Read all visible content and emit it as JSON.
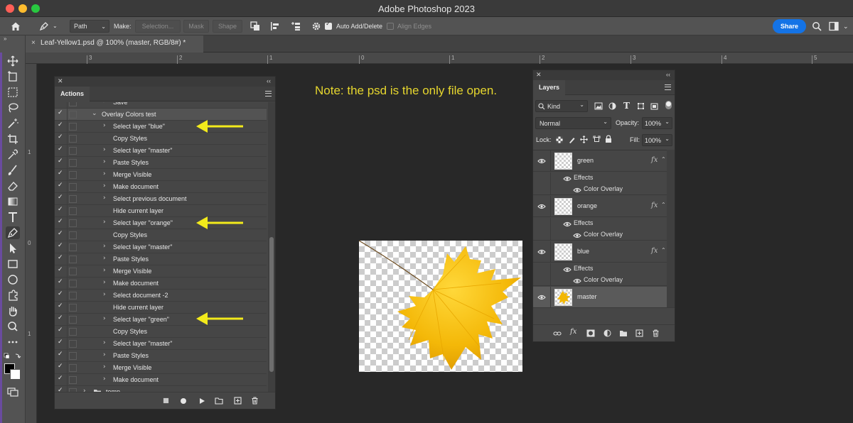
{
  "app_title": "Adobe Photoshop 2023",
  "options_bar": {
    "path_mode": "Path",
    "make_label": "Make:",
    "selection_btn": "Selection...",
    "mask_btn": "Mask",
    "shape_btn": "Shape",
    "auto_add_delete": "Auto Add/Delete",
    "align_edges": "Align Edges",
    "share": "Share"
  },
  "document_tab": {
    "close": "×",
    "title": "Leaf-Yellow1.psd @ 100% (master, RGB/8#) *"
  },
  "rulers": {
    "horizontal": [
      "3",
      "2",
      "1",
      "0",
      "1",
      "2",
      "3",
      "4",
      "5"
    ],
    "vertical": [
      "1",
      "0",
      "1"
    ]
  },
  "actions_panel": {
    "tab": "Actions",
    "rows": [
      {
        "level": 2,
        "label": "Save",
        "checked": true,
        "chevron": "›"
      },
      {
        "level": 1,
        "label": "Overlay Colors test",
        "checked": true,
        "chevron": "⌄",
        "selected": true
      },
      {
        "level": 2,
        "label": "Select layer \"blue\"",
        "checked": true,
        "chevron": "›"
      },
      {
        "level": 2,
        "label": "Copy Styles",
        "checked": true,
        "chevron": ""
      },
      {
        "level": 2,
        "label": "Select layer \"master\"",
        "checked": true,
        "chevron": "›"
      },
      {
        "level": 2,
        "label": "Paste Styles",
        "checked": true,
        "chevron": "›"
      },
      {
        "level": 2,
        "label": "Merge Visible",
        "checked": true,
        "chevron": "›"
      },
      {
        "level": 2,
        "label": "Make document",
        "checked": true,
        "chevron": "›"
      },
      {
        "level": 2,
        "label": "Select previous document",
        "checked": true,
        "chevron": "›"
      },
      {
        "level": 2,
        "label": "Hide current layer",
        "checked": true,
        "chevron": ""
      },
      {
        "level": 2,
        "label": "Select layer \"orange\"",
        "checked": true,
        "chevron": "›"
      },
      {
        "level": 2,
        "label": "Copy Styles",
        "checked": true,
        "chevron": ""
      },
      {
        "level": 2,
        "label": "Select layer \"master\"",
        "checked": true,
        "chevron": "›"
      },
      {
        "level": 2,
        "label": "Paste Styles",
        "checked": true,
        "chevron": "›"
      },
      {
        "level": 2,
        "label": "Merge Visible",
        "checked": true,
        "chevron": "›"
      },
      {
        "level": 2,
        "label": "Make document",
        "checked": true,
        "chevron": "›"
      },
      {
        "level": 2,
        "label": "Select document -2",
        "checked": true,
        "chevron": "›"
      },
      {
        "level": 2,
        "label": "Hide current layer",
        "checked": true,
        "chevron": ""
      },
      {
        "level": 2,
        "label": "Select layer \"green\"",
        "checked": true,
        "chevron": "›"
      },
      {
        "level": 2,
        "label": "Copy Styles",
        "checked": true,
        "chevron": ""
      },
      {
        "level": 2,
        "label": "Select layer \"master\"",
        "checked": true,
        "chevron": "›"
      },
      {
        "level": 2,
        "label": "Paste Styles",
        "checked": true,
        "chevron": "›"
      },
      {
        "level": 2,
        "label": "Merge Visible",
        "checked": true,
        "chevron": "›"
      },
      {
        "level": 2,
        "label": "Make document",
        "checked": true,
        "chevron": "›"
      },
      {
        "level": 0,
        "label": "temp",
        "checked": true,
        "chevron": "›",
        "folder": true
      }
    ]
  },
  "layers_panel": {
    "tab": "Layers",
    "filter_kind": "Kind",
    "blend_mode": "Normal",
    "opacity_label": "Opacity:",
    "opacity_value": "100%",
    "lock_label": "Lock:",
    "fill_label": "Fill:",
    "fill_value": "100%",
    "layers": [
      {
        "name": "green",
        "fx": "fx",
        "effects_label": "Effects",
        "effect": "Color Overlay"
      },
      {
        "name": "orange",
        "fx": "fx",
        "effects_label": "Effects",
        "effect": "Color Overlay"
      },
      {
        "name": "blue",
        "fx": "fx",
        "effects_label": "Effects",
        "effect": "Color Overlay"
      },
      {
        "name": "master",
        "fx": "",
        "selected": true
      }
    ]
  },
  "annotation": {
    "note": "Note: the psd is the only file open.",
    "arrow_color": "#f2ea1b"
  },
  "colors": {
    "accent": "#1473e6",
    "note_text": "#e6d62e",
    "leaf": "#f2b705"
  }
}
